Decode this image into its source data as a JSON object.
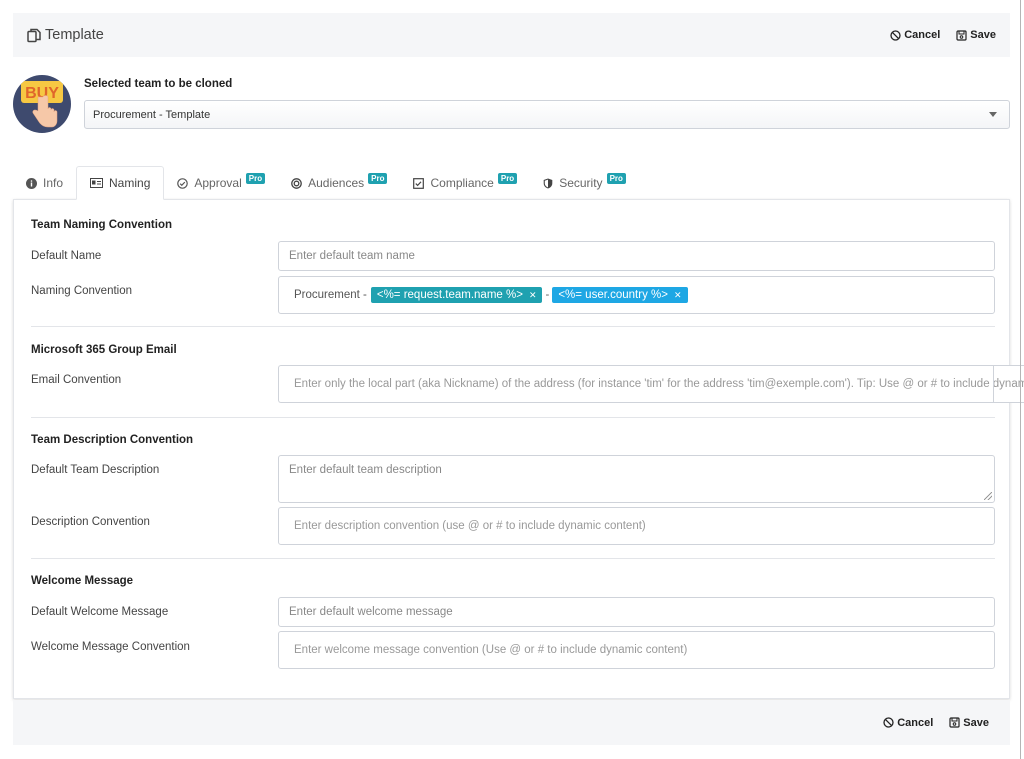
{
  "header": {
    "title": "Template",
    "title_icon": "copy-icon",
    "cancel_label": "Cancel",
    "save_label": "Save"
  },
  "team_select": {
    "label": "Selected team to be cloned",
    "value": "Procurement - Template",
    "avatar_text": "BUY"
  },
  "tabs": [
    {
      "label": "Info",
      "icon": "info-icon",
      "pro": false,
      "active": false
    },
    {
      "label": "Naming",
      "icon": "id-card-icon",
      "pro": false,
      "active": true
    },
    {
      "label": "Approval",
      "icon": "check-circle-icon",
      "pro": true,
      "active": false
    },
    {
      "label": "Audiences",
      "icon": "target-icon",
      "pro": true,
      "active": false
    },
    {
      "label": "Compliance",
      "icon": "checkbox-icon",
      "pro": true,
      "active": false
    },
    {
      "label": "Security",
      "icon": "shield-icon",
      "pro": true,
      "active": false
    }
  ],
  "pro_badge": "Pro",
  "sections": {
    "naming": {
      "title": "Team Naming Convention",
      "default_name_label": "Default Name",
      "default_name_placeholder": "Enter default team name",
      "convention_label": "Naming Convention",
      "convention_prefix": "Procurement -",
      "convention_separator": "-",
      "tokens": [
        {
          "text": "<%= request.team.name %>",
          "color": "#1fa1b0"
        },
        {
          "text": "<%= user.country %>",
          "color": "#1ea7e4"
        }
      ]
    },
    "email": {
      "title": "Microsoft 365 Group Email",
      "convention_label": "Email Convention",
      "convention_placeholder": "Enter only the local part (aka Nickname) of the address (for instance 'tim' for the address 'tim@exemple.com'). Tip: Use @ or # to include dynamic content"
    },
    "description": {
      "title": "Team Description Convention",
      "default_label": "Default Team Description",
      "default_placeholder": "Enter default team description",
      "convention_label": "Description Convention",
      "convention_placeholder": "Enter description convention (use @ or # to include dynamic content)"
    },
    "welcome": {
      "title": "Welcome Message",
      "default_label": "Default Welcome Message",
      "default_placeholder": "Enter default welcome message",
      "convention_label": "Welcome Message Convention",
      "convention_placeholder": "Enter welcome message convention (Use @ or # to include dynamic content)"
    }
  },
  "footer": {
    "cancel_label": "Cancel",
    "save_label": "Save"
  }
}
